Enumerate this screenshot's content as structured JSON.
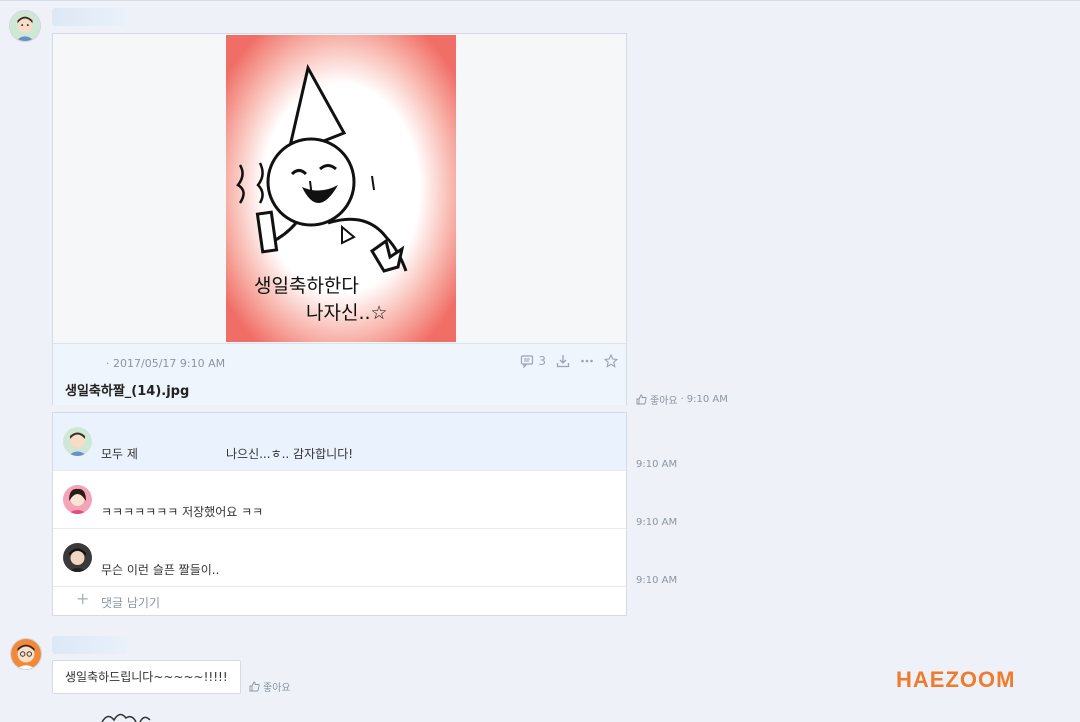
{
  "post": {
    "meta": "· 2017/05/17 9:10 AM",
    "filename": "생일축하짤_(14).jpg",
    "comment_count": "3",
    "like_label": "좋아요",
    "time": "9:10 AM",
    "image_text": {
      "line1": "생일축하한다",
      "line2": "나자신..☆"
    }
  },
  "comments": [
    {
      "author": "모두 제",
      "text": "나으신...ㅎ.. 감자합니다!",
      "time": "9:10 AM"
    },
    {
      "author": "",
      "text": "ㅋㅋㅋㅋㅋㅋㅋ 저장했어요 ㅋㅋ",
      "time": "9:10 AM"
    },
    {
      "author": "",
      "text": "무슨 이런 슬픈 짤들이..",
      "time": "9:10 AM"
    }
  ],
  "add_comment_label": "댓글 남기기",
  "reply": {
    "text": "생일축하드립니다~~~~~!!!!!",
    "like_label": "좋아요"
  },
  "brand": "HAEZOOM",
  "colors": {
    "accent": "#f07b2e",
    "highlight": "#eaf3fd",
    "image_bg": "#f07069"
  }
}
